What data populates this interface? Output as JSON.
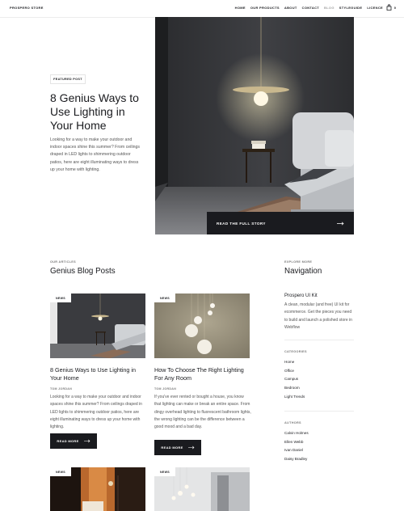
{
  "nav": {
    "logo": "PROSPERO STORE",
    "links": [
      "HOME",
      "OUR PRODUCTS",
      "ABOUT",
      "CONTACT",
      "BLOG",
      "STYLEGUIDE",
      "LICENCE"
    ],
    "active": "BLOG",
    "cart_count": "0"
  },
  "hero": {
    "badge": "FEATURED POST",
    "title": "8 Genius Ways to Use Lighting in Your Home",
    "excerpt": "Looking for a way to make your outdoor and indoor spaces shine this summer? From ceilings draped in LED lights to shimmering outdoor patios, here are eight illuminating ways to dress up your home with lighting.",
    "cta": "READ THE FULL STORY"
  },
  "blog": {
    "kicker": "OUR ARTICLES",
    "title": "Genius Blog Posts",
    "posts": [
      {
        "tag": "NEWS",
        "title": "8 Genius Ways to Use Lighting in Your Home",
        "author": "TOM JORDAN",
        "excerpt": "Looking for a way to make your outdoor and indoor spaces shine this summer? From ceilings draped in LED lights to shimmering outdoor patios, here are eight illuminating ways to dress up your home with lighting.",
        "button": "READ MORE"
      },
      {
        "tag": "NEWS",
        "title": "How To Choose The Right Lighting For Any Room",
        "author": "TOM JORDAN",
        "excerpt": "If you've ever rented or bought a house, you know that lighting can make or break an entire space. From dingy overhead lighting to fluorescent bathroom lights, the wrong lighting can be the difference between a good mood and a bad day.",
        "button": "READ MORE"
      },
      {
        "tag": "NEWS"
      },
      {
        "tag": "NEWS"
      }
    ]
  },
  "sidebar": {
    "kicker": "EXPLORE MORE",
    "title": "Navigation",
    "kit_title": "Prospero UI Kit",
    "kit_text": "A clean, modular (and free) UI kit for ecommerce. Get the pieces you need to build and launch a polished store in Webflow",
    "categories_label": "CATEGORIES",
    "categories": [
      "Home",
      "Office",
      "Campus",
      "Bedroom",
      "Light Trends"
    ],
    "authors_label": "AUTHORS",
    "authors": [
      "Calvin Holmes",
      "Ellen Webb",
      "Ivan Daniel",
      "Daisy Bradley"
    ]
  },
  "colors": {
    "dark": "#1a1b1f",
    "muted": "#7b7b7b",
    "active_link": "#a2a2a2"
  }
}
